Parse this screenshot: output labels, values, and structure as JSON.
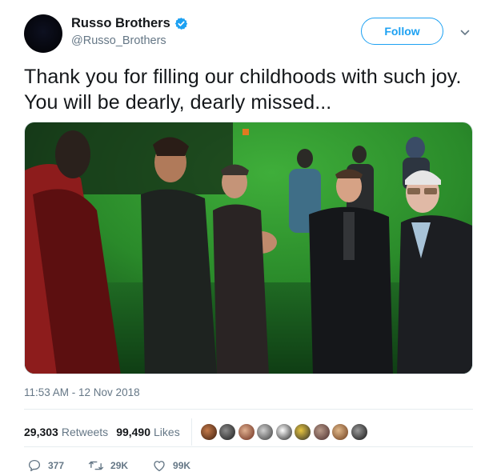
{
  "user": {
    "display_name": "Russo Brothers",
    "handle": "@Russo_Brothers",
    "avatar_icon": "avatar",
    "verified_icon": "verified-badge-icon"
  },
  "follow": {
    "label": "Follow"
  },
  "menu": {
    "icon": "chevron-down-icon"
  },
  "tweet": {
    "text": "Thank you for filling our childhoods with such joy. You will be dearly, dearly missed...",
    "timestamp": "11:53 AM - 12 Nov 2018"
  },
  "stats": {
    "retweets": {
      "count": "29,303",
      "label": "Retweets"
    },
    "likes": {
      "count": "99,490",
      "label": "Likes"
    }
  },
  "actions": {
    "reply": {
      "icon": "reply-icon",
      "count": "377"
    },
    "retweet": {
      "icon": "retweet-icon",
      "count": "29K"
    },
    "like": {
      "icon": "heart-icon",
      "count": "99K"
    }
  },
  "colors": {
    "accent": "#1da1f2",
    "secondary_text": "#657786",
    "primary_text": "#14171a",
    "divider": "#e6ecf0"
  }
}
